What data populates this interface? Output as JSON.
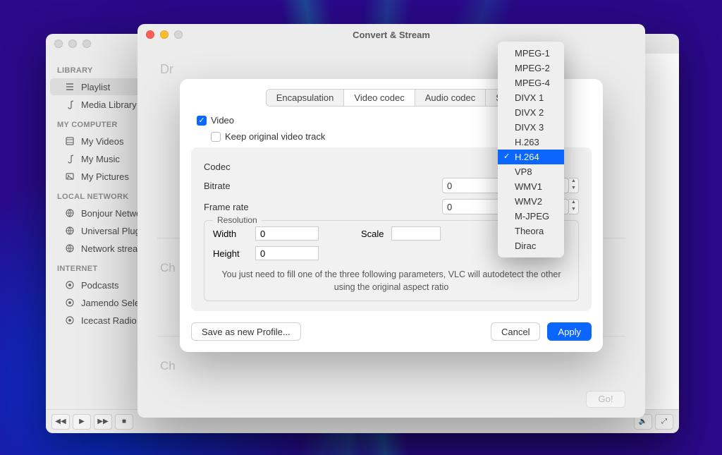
{
  "sidebar": {
    "headers": {
      "library": "LIBRARY",
      "computer": "MY COMPUTER",
      "network": "LOCAL NETWORK",
      "internet": "INTERNET"
    },
    "library": [
      {
        "label": "Playlist",
        "icon": "list"
      },
      {
        "label": "Media Library",
        "icon": "music-note"
      }
    ],
    "computer": [
      {
        "label": "My Videos",
        "icon": "film"
      },
      {
        "label": "My Music",
        "icon": "music-note"
      },
      {
        "label": "My Pictures",
        "icon": "picture"
      }
    ],
    "network": [
      {
        "label": "Bonjour Network",
        "icon": "globe"
      },
      {
        "label": "Universal Plug",
        "icon": "globe"
      },
      {
        "label": "Network streams",
        "icon": "globe"
      }
    ],
    "internet": [
      {
        "label": "Podcasts",
        "icon": "podcast"
      },
      {
        "label": "Jamendo Selections",
        "icon": "podcast"
      },
      {
        "label": "Icecast Radio",
        "icon": "podcast"
      }
    ]
  },
  "sheet": {
    "title": "Convert & Stream",
    "drop_hint_prefix": "Dr",
    "section2": "Ch",
    "section3": "Ch",
    "go_label": "Go!"
  },
  "modal": {
    "tabs": [
      "Encapsulation",
      "Video codec",
      "Audio codec",
      "Subtitles"
    ],
    "video_checkbox": "Video",
    "keep_original": "Keep original video track",
    "codec_label": "Codec",
    "bitrate_label": "Bitrate",
    "bitrate_value": "0",
    "framerate_label": "Frame rate",
    "framerate_value": "0",
    "resolution_label": "Resolution",
    "width_label": "Width",
    "width_value": "0",
    "height_label": "Height",
    "height_value": "0",
    "scale_label": "Scale",
    "hint": "You just need to fill one of the three following parameters, VLC will autodetect the other using the original aspect ratio",
    "save_profile": "Save as new Profile...",
    "cancel": "Cancel",
    "apply": "Apply"
  },
  "dropdown": {
    "items": [
      "MPEG-1",
      "MPEG-2",
      "MPEG-4",
      "DIVX 1",
      "DIVX 2",
      "DIVX 3",
      "H.263",
      "H.264",
      "VP8",
      "WMV1",
      "WMV2",
      "M-JPEG",
      "Theora",
      "Dirac"
    ],
    "selected": "H.264"
  }
}
